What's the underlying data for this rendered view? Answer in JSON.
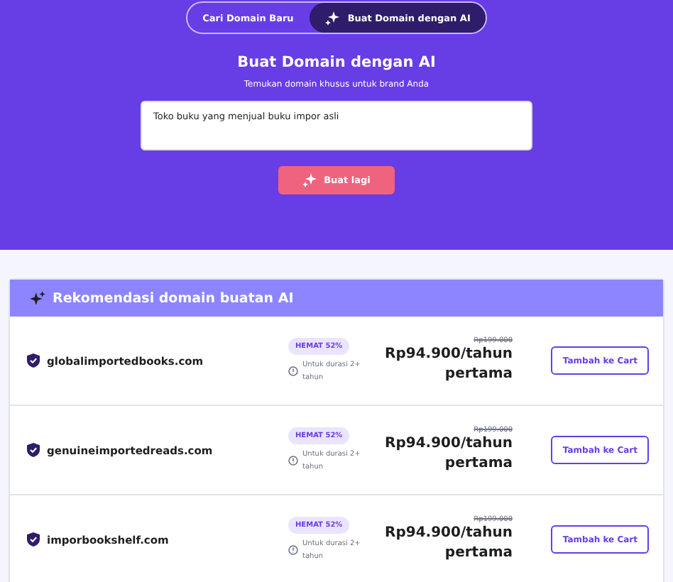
{
  "tabs": [
    {
      "label": "Cari Domain Baru",
      "selected": false,
      "icon": false
    },
    {
      "label": "Buat Domain dengan AI",
      "selected": true,
      "icon": true
    }
  ],
  "hero": {
    "title": "Buat Domain dengan AI",
    "subtitle": "Temukan domain khusus untuk brand Anda",
    "prompt": "Toko buku yang menjual buku impor asli",
    "button": "Buat lagi"
  },
  "results": {
    "title": "Rekomendasi domain buatan AI",
    "rows": [
      {
        "domain": "globalimportedbooks.com",
        "badge": "HEMAT 52%",
        "note": "Untuk durasi 2+ tahun",
        "old_price": "Rp199.000",
        "price": "Rp94.900/tahun pertama",
        "button": "Tambah ke Cart"
      },
      {
        "domain": "genuineimportedreads.com",
        "badge": "HEMAT 52%",
        "note": "Untuk durasi 2+ tahun",
        "old_price": "Rp199.000",
        "price": "Rp94.900/tahun pertama",
        "button": "Tambah ke Cart"
      },
      {
        "domain": "imporbookshelf.com",
        "badge": "HEMAT 52%",
        "note": "Untuk durasi 2+ tahun",
        "old_price": "Rp199.000",
        "price": "Rp94.900/tahun pertama",
        "button": "Tambah ke Cart"
      }
    ]
  }
}
